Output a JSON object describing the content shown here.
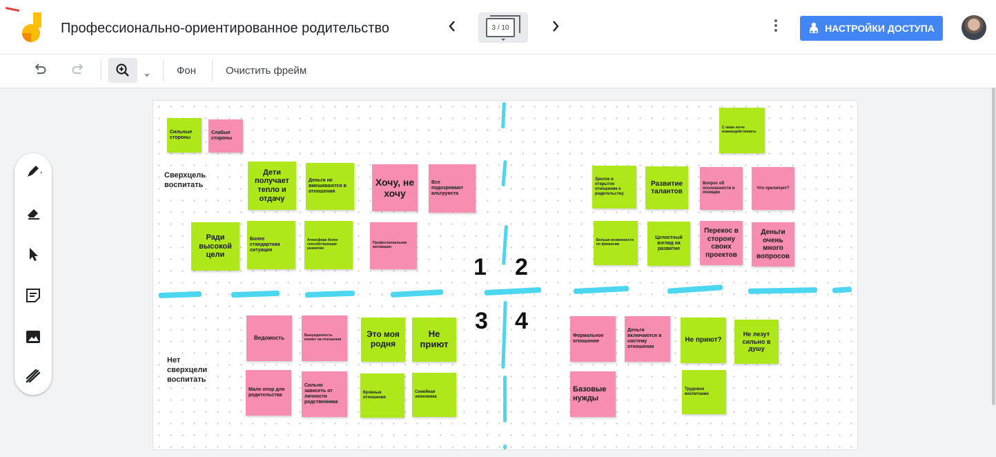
{
  "header": {
    "title": "Профессионально-ориентированное родительство",
    "frame_indicator": "3 / 10",
    "share_label": "НАСТРОЙКИ ДОСТУПА"
  },
  "toolbar": {
    "background_label": "Фон",
    "clear_label": "Очистить фрейм"
  },
  "canvas": {
    "labels": {
      "supergoal": "Сверхцель воспитать",
      "no_supergoal": "Нет сверхцели воспитать"
    },
    "quadrant_numbers": [
      "1",
      "2",
      "3",
      "4"
    ],
    "notes": [
      {
        "text": "Сильные стороны",
        "color": "green"
      },
      {
        "text": "Слабые стороны",
        "color": "pink"
      },
      {
        "text": "Дети получает тепло и отдачу",
        "color": "green"
      },
      {
        "text": "Деньги не вмешиваются в отношения",
        "color": "green"
      },
      {
        "text": "Хочу, не хочу",
        "color": "pink"
      },
      {
        "text": "Все подозревают альтруиста",
        "color": "pink"
      },
      {
        "text": "Ради высокой цели",
        "color": "green"
      },
      {
        "text": "Более стандартная ситуация",
        "color": "green"
      },
      {
        "text": "Атмосфера более способствующая развитию",
        "color": "green"
      },
      {
        "text": "Профессиональная мотивация",
        "color": "pink"
      },
      {
        "text": "С ними легче взаимодействовать",
        "color": "green"
      },
      {
        "text": "Зрелое и открытое отношение к родительству",
        "color": "green"
      },
      {
        "text": "Развитие талантов",
        "color": "green"
      },
      {
        "text": "Вопрос об осознанности и позиции",
        "color": "pink"
      },
      {
        "text": "Что преличует?",
        "color": "pink"
      },
      {
        "text": "Больше возможности по финансам",
        "color": "green"
      },
      {
        "text": "Целостный взгляд на развитие",
        "color": "green"
      },
      {
        "text": "Перекос в сторону своих проектов",
        "color": "pink"
      },
      {
        "text": "Деньги очень много вопросов",
        "color": "pink"
      },
      {
        "text": "Ведомость",
        "color": "pink"
      },
      {
        "text": "Вынужденность влияет на отношения",
        "color": "pink"
      },
      {
        "text": "Это моя родня",
        "color": "green"
      },
      {
        "text": "Не приют",
        "color": "green"
      },
      {
        "text": "Мало опор для родительства",
        "color": "pink"
      },
      {
        "text": "Сильно зависеть от личности родственника",
        "color": "pink"
      },
      {
        "text": "Кровные отношения",
        "color": "green"
      },
      {
        "text": "Семейная экономика",
        "color": "green"
      },
      {
        "text": "Формальное отношение",
        "color": "pink"
      },
      {
        "text": "Деньги включаются в систему отношения",
        "color": "pink"
      },
      {
        "text": "Не приют?",
        "color": "green"
      },
      {
        "text": "Не лезут сильно в душу",
        "color": "green"
      },
      {
        "text": "Базовые нужды",
        "color": "pink"
      },
      {
        "text": "Трудовое воспитание",
        "color": "green"
      }
    ]
  },
  "colors": {
    "accent": "#4285f4",
    "note_green": "#aee81b",
    "note_pink": "#f78db0",
    "marker_cyan": "#4dd6f0"
  },
  "icons": [
    "undo-icon",
    "redo-icon",
    "zoom-in-icon",
    "chevron-left-icon",
    "chevron-right-icon",
    "more-vert-icon",
    "people-icon",
    "pen-icon",
    "eraser-icon",
    "select-icon",
    "sticky-note-icon",
    "image-icon",
    "laser-icon"
  ]
}
